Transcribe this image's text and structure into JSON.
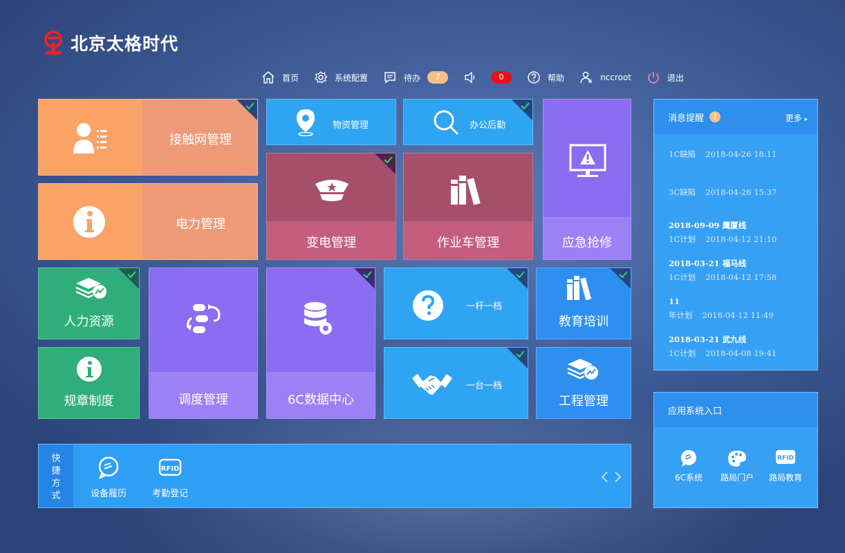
{
  "brand": {
    "title": "北京太格时代"
  },
  "nav": {
    "home": "首页",
    "config": "系统配置",
    "todo": "待办",
    "todo_count": "7",
    "sound_count": "0",
    "help": "帮助",
    "user": "nccroot",
    "logout": "退出"
  },
  "tiles": {
    "catenary": "接触网管理",
    "power": "电力管理",
    "materials": "物资管理",
    "office": "办公后勤",
    "substation": "变电管理",
    "vehicle": "作业车管理",
    "emergency": "应急抢修",
    "hr": "人力资源",
    "rules": "规章制度",
    "dispatch": "调度管理",
    "data6c": "6C数据中心",
    "pole": "一杆一档",
    "unit": "一台一档",
    "training": "教育培训",
    "engineering": "工程管理"
  },
  "messages": {
    "title": "消息提醒",
    "more": "更多",
    "items": [
      {
        "line1": "1C缺陷",
        "time": "2018-04-26 18:11"
      },
      {
        "line1": "3C缺陷",
        "time": "2018-04-26 15:37"
      },
      {
        "head": "2018-09-09  鹰厦线",
        "line1": "1C计划",
        "time": "2018-04-12 21:10"
      },
      {
        "head": "2018-03-21  福马线",
        "line1": "1C计划",
        "time": "2018-04-12 17:58"
      },
      {
        "head": "11",
        "line1": "年计划",
        "time": "2018-04-12 11:49"
      },
      {
        "head": "2018-03-21  武九线",
        "line1": "1C计划",
        "time": "2018-04-08 19:41"
      }
    ]
  },
  "apps": {
    "title": "应用系统入口",
    "items": [
      "6C系统",
      "路局门户",
      "路局教育"
    ]
  },
  "shortcuts": {
    "title_chars": [
      "快",
      "捷",
      "方",
      "式"
    ],
    "items": [
      "设备履历",
      "考勤登记"
    ]
  },
  "colors": {
    "orange_tile": "#f9a367",
    "rose_tile": "#c55d7f",
    "violet_tile": "#8a6df1",
    "green_tile": "#2fae7c",
    "blue_tile": "#2ea4f2",
    "badge_red": "#e8121c"
  }
}
